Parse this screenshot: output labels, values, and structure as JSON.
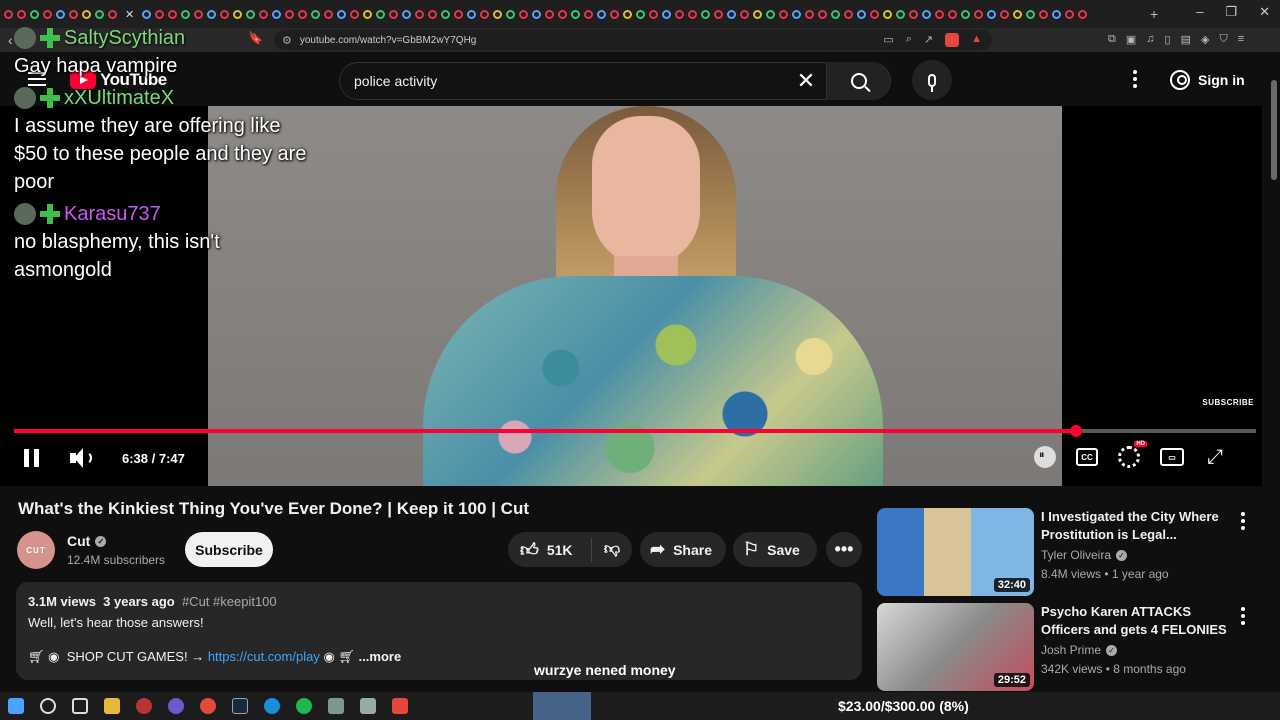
{
  "browser": {
    "url": "youtube.com/watch?v=GbBM2wY7QHg"
  },
  "youtube": {
    "logo_text": "YouTube",
    "search": {
      "value": "police activity"
    },
    "sign_in_label": "Sign in"
  },
  "player": {
    "time": "6:38 / 7:47",
    "progress": 0.855,
    "watermark": "SUBSCRIBE"
  },
  "chat": {
    "lines": [
      {
        "kind": "text",
        "text": "Gay hapa vampire"
      },
      {
        "kind": "user",
        "text": "xXUltimateX",
        "color": "#7dd97a"
      },
      {
        "kind": "text",
        "text": "I assume they are offering like"
      },
      {
        "kind": "text",
        "text": "$50 to these people and they are"
      },
      {
        "kind": "text",
        "text": "poor"
      },
      {
        "kind": "user",
        "text": "Karasu737",
        "color": "#c55cf0"
      },
      {
        "kind": "text",
        "text": "no blasphemy, this isn't"
      },
      {
        "kind": "text",
        "text": "asmongold"
      }
    ],
    "top_user": "SaltyScythian"
  },
  "video": {
    "title": "What's the Kinkiest Thing You've Ever Done? | Keep it 100 | Cut",
    "channel": "Cut",
    "channel_avatar_text": "CUT",
    "subscribers": "12.4M subscribers",
    "subscribe_label": "Subscribe",
    "likes": "51K",
    "share_label": "Share",
    "save_label": "Save"
  },
  "description": {
    "views": "3.1M views",
    "age": "3 years ago",
    "tags": "#Cut #keepit100",
    "line2": "Well, let's hear those answers!",
    "shop_text": "SHOP CUT GAMES! →",
    "shop_link": "https://cut.com/play",
    "more_label": "...more"
  },
  "caption": "wurzye nened money",
  "recommendations": [
    {
      "title": "I Investigated the City Where Prostitution is Legal...",
      "channel": "Tyler Oliveira",
      "meta": "8.4M views • 1 year ago",
      "duration": "32:40"
    },
    {
      "title": "Psycho Karen ATTACKS Officers and gets 4 FELONIES",
      "channel": "Josh Prime",
      "meta": "342K views • 8 months ago",
      "duration": "29:52"
    }
  ],
  "taskbar": {
    "donation": "$23.00/$300.00 (8%)"
  },
  "colors": {
    "accent": "#ff0033",
    "link": "#3ea6ff"
  }
}
